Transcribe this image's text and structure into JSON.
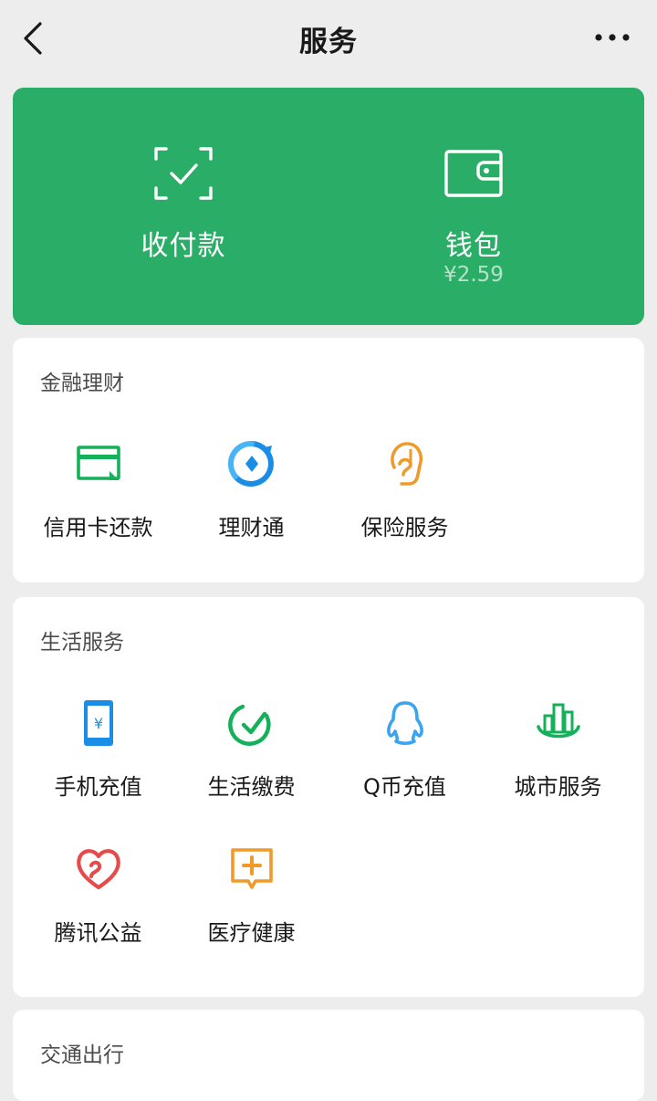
{
  "header": {
    "title": "服务"
  },
  "pay_card": {
    "color": "#2aae67",
    "pay": {
      "label": "收付款"
    },
    "wallet": {
      "label": "钱包",
      "balance": "¥2.59"
    }
  },
  "sections": {
    "finance": {
      "title": "金融理财",
      "items": [
        {
          "label": "信用卡还款",
          "icon": "credit-card-icon"
        },
        {
          "label": "理财通",
          "icon": "wealth-icon"
        },
        {
          "label": "保险服务",
          "icon": "insurance-icon"
        }
      ]
    },
    "life": {
      "title": "生活服务",
      "items": [
        {
          "label": "手机充值",
          "icon": "phone-topup-icon"
        },
        {
          "label": "生活缴费",
          "icon": "utility-bill-icon"
        },
        {
          "label": "Q币充值",
          "icon": "qq-coin-icon"
        },
        {
          "label": "城市服务",
          "icon": "city-service-icon"
        },
        {
          "label": "腾讯公益",
          "icon": "charity-heart-icon"
        },
        {
          "label": "医疗健康",
          "icon": "medical-icon"
        }
      ]
    },
    "transport": {
      "title": "交通出行"
    }
  }
}
